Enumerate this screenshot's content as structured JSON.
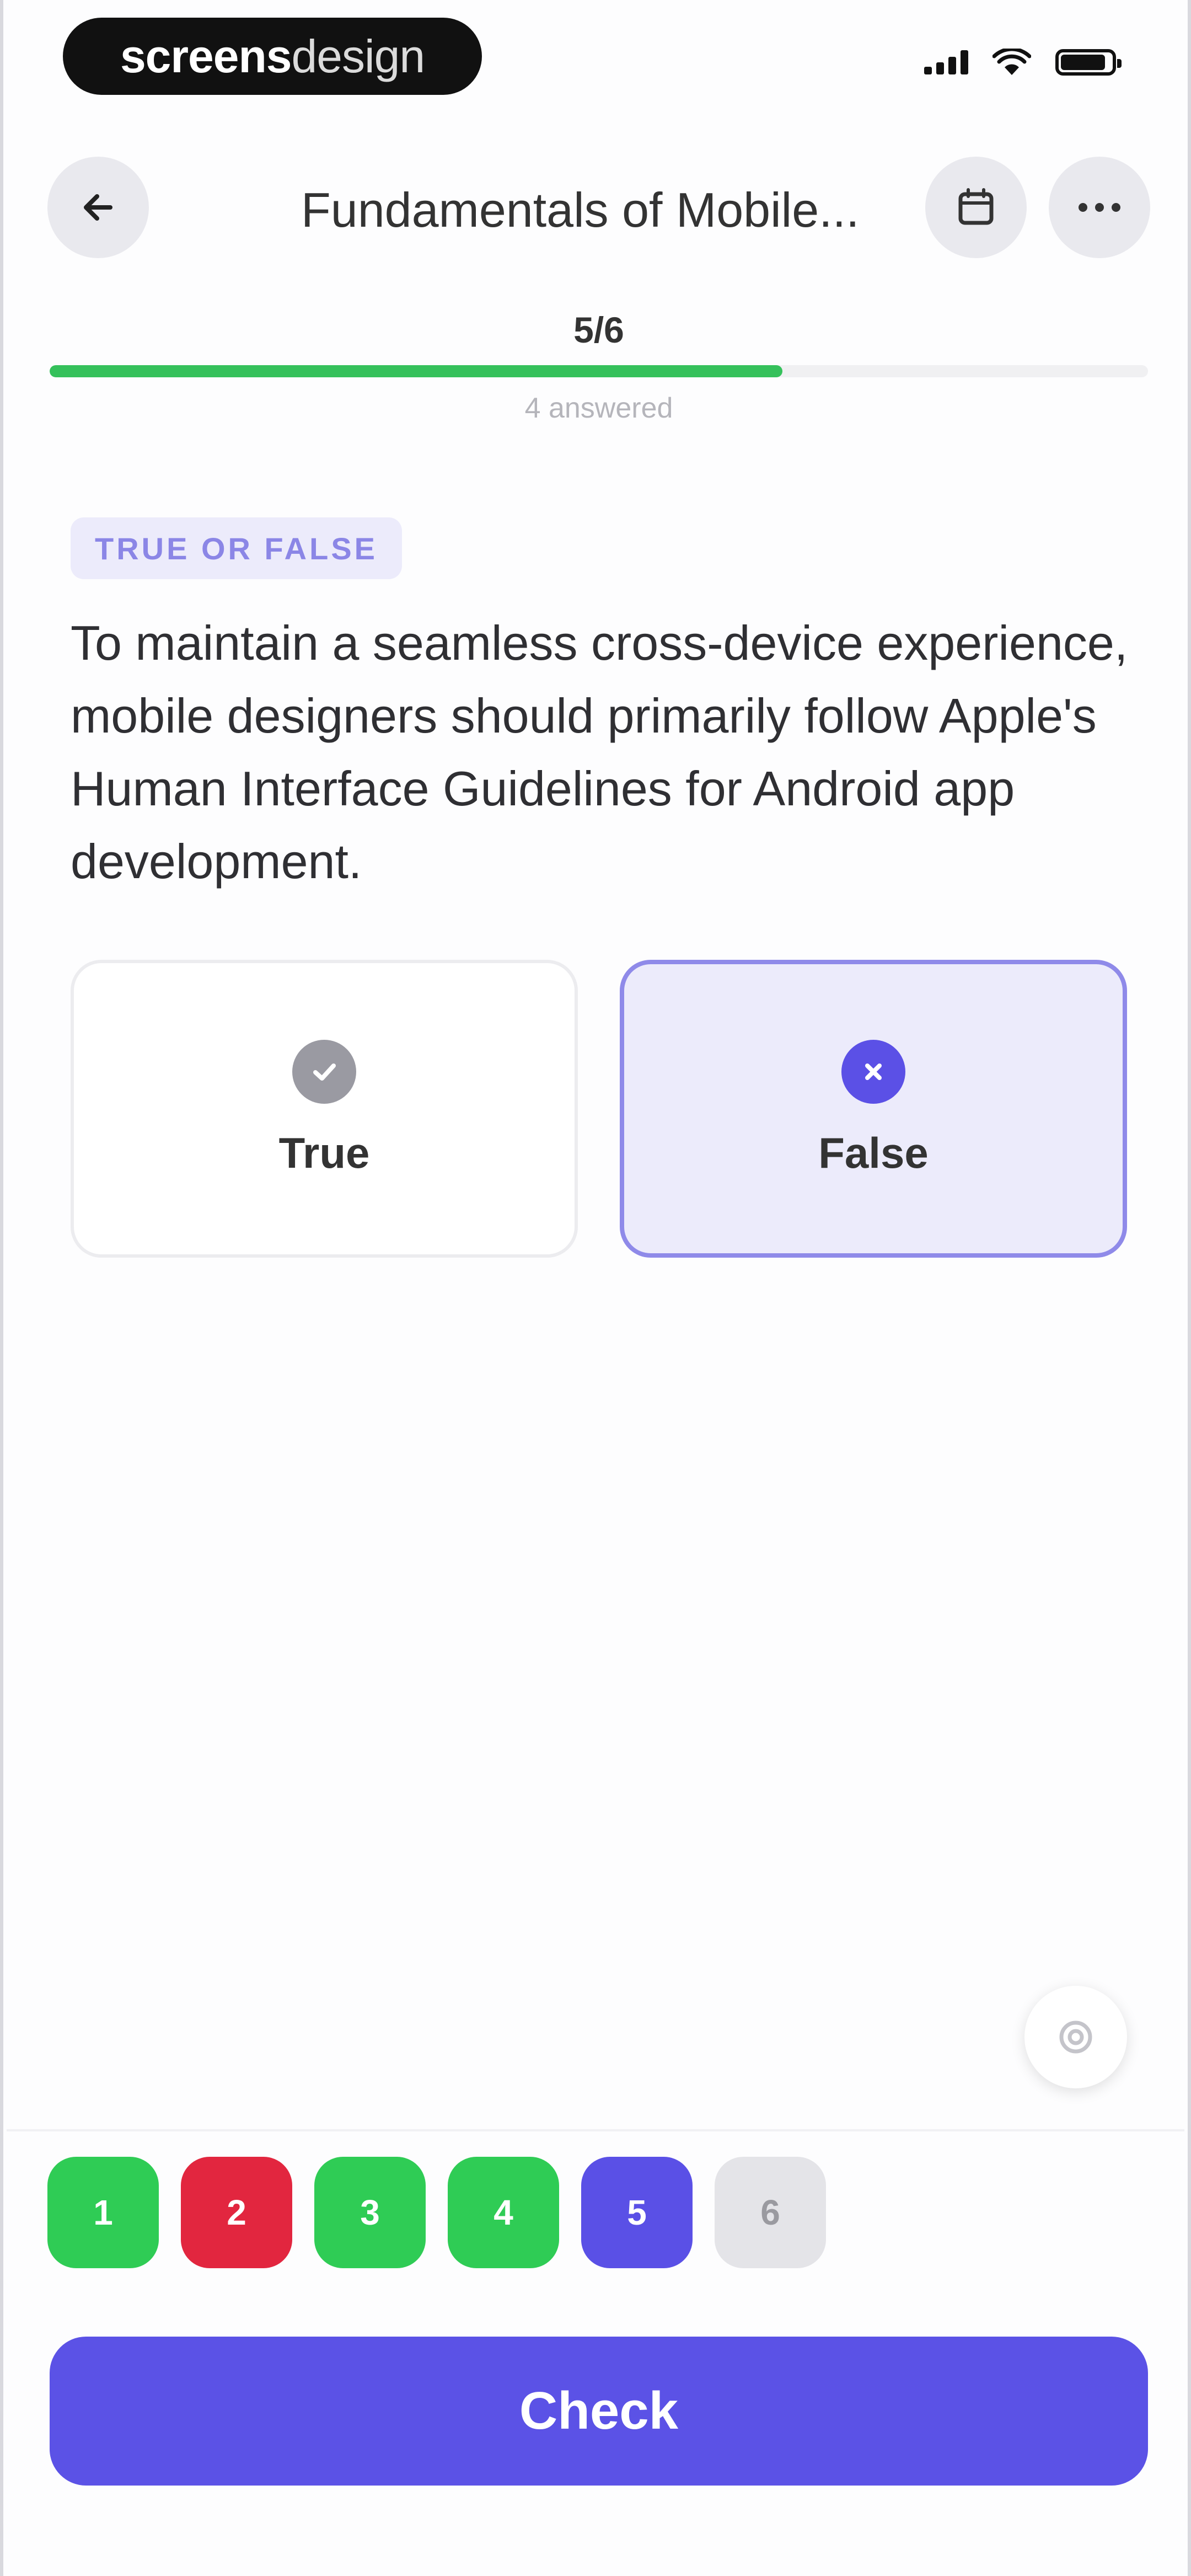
{
  "status_bar": {
    "brand_bold": "screens",
    "brand_light": "design",
    "icons": [
      "cellular-signal-icon",
      "wifi-icon",
      "battery-icon"
    ]
  },
  "header": {
    "title": "Fundamentals of Mobile...",
    "back_icon": "arrow-left-icon",
    "calendar_icon": "calendar-icon",
    "more_icon": "ellipsis-icon"
  },
  "progress": {
    "current": "5/6",
    "answered_text": "4 answered",
    "fraction": 0.667,
    "color": "#35c15b"
  },
  "question": {
    "type_label": "TRUE OR FALSE",
    "text": "To maintain a seamless cross-device experience, mobile designers should primarily follow Apple's Human Interface Guidelines for Android app development."
  },
  "options": [
    {
      "label": "True",
      "icon": "check-circle-icon",
      "selected": false
    },
    {
      "label": "False",
      "icon": "x-circle-icon",
      "selected": true
    }
  ],
  "floating_button_icon": "settings-icon",
  "question_nav": [
    {
      "number": "1",
      "state": "correct"
    },
    {
      "number": "2",
      "state": "wrong"
    },
    {
      "number": "3",
      "state": "correct"
    },
    {
      "number": "4",
      "state": "correct"
    },
    {
      "number": "5",
      "state": "current"
    },
    {
      "number": "6",
      "state": "pending"
    }
  ],
  "colors": {
    "accent": "#5b52e6",
    "correct": "#2fcc55",
    "wrong": "#e2263f",
    "pending": "#e4e4e8"
  },
  "check_button": {
    "label": "Check"
  }
}
